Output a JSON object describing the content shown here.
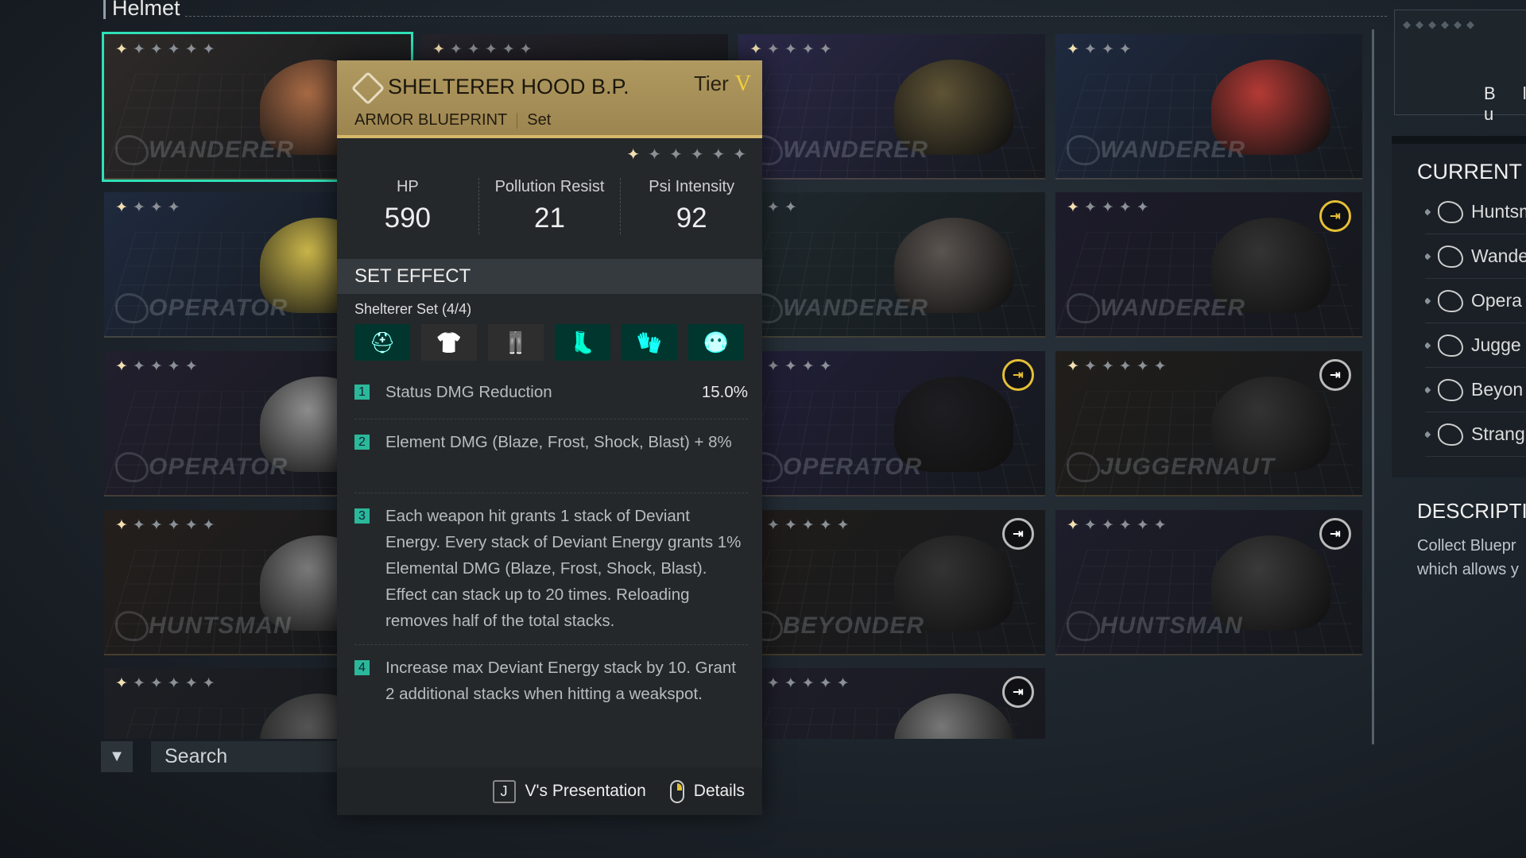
{
  "section_title": "Helmet",
  "search": {
    "placeholder": "Search"
  },
  "cards": [
    {
      "col": 0,
      "row": 0,
      "stars": 6,
      "brand": "WANDERER",
      "bg": "#2e2a28",
      "helmet": "#a86a45",
      "selected": true,
      "badge": null
    },
    {
      "col": 0,
      "row": 1,
      "stars": 4,
      "brand": "OPERATOR",
      "bg": "#1f2a3e",
      "helmet": "#c9b54a",
      "badge": null
    },
    {
      "col": 0,
      "row": 2,
      "stars": 5,
      "brand": "OPERATOR",
      "bg": "#221f2e",
      "helmet": "#8d8d8d",
      "badge": null
    },
    {
      "col": 0,
      "row": 3,
      "stars": 6,
      "brand": "HUNTSMAN",
      "bg": "#241f1c",
      "helmet": "#7a7a7a",
      "badge": null
    },
    {
      "col": 0,
      "row": 4,
      "stars": 6,
      "brand": "",
      "bg": "#1d1f24",
      "helmet": "#555",
      "badge": null
    },
    {
      "col": 1,
      "row": 0,
      "stars": 6,
      "brand": "",
      "bg": "#25232a",
      "helmet": "#555",
      "badge": null
    },
    {
      "col": 2,
      "row": 0,
      "stars": 5,
      "brand": "WANDERER",
      "bg": "#2a2848",
      "helmet": "#5e5335",
      "badge": null
    },
    {
      "col": 2,
      "row": 1,
      "stars": 3,
      "brand": "WANDERER",
      "bg": "#1f2a2e",
      "helmet": "#5b5450",
      "badge": null
    },
    {
      "col": 2,
      "row": 2,
      "stars": 5,
      "brand": "OPERATOR",
      "bg": "#211f38",
      "helmet": "#1e1e22",
      "badge": "gold"
    },
    {
      "col": 2,
      "row": 3,
      "stars": 6,
      "brand": "BEYONDER",
      "bg": "#201d1b",
      "helmet": "#333",
      "badge": "grey"
    },
    {
      "col": 2,
      "row": 4,
      "stars": 6,
      "brand": "",
      "bg": "#1f1e2a",
      "helmet": "#777",
      "badge": "grey"
    },
    {
      "col": 3,
      "row": 0,
      "stars": 4,
      "brand": "WANDERER",
      "bg": "#1f2a40",
      "helmet": "#b43a35",
      "badge": null
    },
    {
      "col": 3,
      "row": 1,
      "stars": 5,
      "brand": "WANDERER",
      "bg": "#1d1b2a",
      "helmet": "#333",
      "badge": "gold"
    },
    {
      "col": 3,
      "row": 2,
      "stars": 6,
      "brand": "JUGGERNAUT",
      "bg": "#211e1b",
      "helmet": "#333",
      "badge": "grey"
    },
    {
      "col": 3,
      "row": 3,
      "stars": 6,
      "brand": "HUNTSMAN",
      "bg": "#1e1d2b",
      "helmet": "#3a3a3a",
      "badge": "grey"
    }
  ],
  "tooltip": {
    "title": "SHELTERER HOOD B.P.",
    "tier_label": "Tier",
    "tier_value": "V",
    "type": "ARMOR BLUEPRINT",
    "category": "Set",
    "stars": 6,
    "stats": [
      {
        "label": "HP",
        "value": "590"
      },
      {
        "label": "Pollution Resist",
        "value": "21"
      },
      {
        "label": "Psi Intensity",
        "value": "92"
      }
    ],
    "set_effect_header": "SET EFFECT",
    "set_name": "Shelterer Set (4/4)",
    "set_pieces": [
      {
        "name": "helmet",
        "glyph": "⛑",
        "active": true
      },
      {
        "name": "top",
        "glyph": "👕",
        "active": false
      },
      {
        "name": "pants",
        "glyph": "👖",
        "active": false
      },
      {
        "name": "boots",
        "glyph": "👢",
        "active": true
      },
      {
        "name": "gloves",
        "glyph": "🧤",
        "active": true
      },
      {
        "name": "mask",
        "glyph": "😷",
        "active": true
      }
    ],
    "effects": [
      {
        "num": "1",
        "text": "Status DMG Reduction",
        "value": "15.0%"
      },
      {
        "num": "2",
        "text": "Element DMG (Blaze, Frost, Shock, Blast) + 8%"
      },
      {
        "num": "3",
        "text": "Each weapon hit grants 1 stack of Deviant Energy. Every stack of Deviant Energy grants 1% Elemental DMG (Blaze, Frost, Shock, Blast). Effect can stack up to 20 times. Reloading removes half of the total stacks."
      },
      {
        "num": "4",
        "text": "Increase max Deviant Energy stack by 10. Grant 2 additional stacks when hitting a weakspot."
      }
    ],
    "footer": {
      "key": "J",
      "presentation": "V's Presentation",
      "details": "Details"
    }
  },
  "right_panel": {
    "preview_text": "B l u",
    "current_header": "CURRENT",
    "items": [
      "Huntsm",
      "Wande",
      "Opera",
      "Jugge",
      "Beyon",
      "Strang"
    ],
    "description_header": "DESCRIPTI",
    "description_lines": [
      "Collect Bluepr",
      "which allows y"
    ]
  },
  "colors": {
    "accent": "#2fe0b8",
    "gold": "#e4bf35",
    "tooltip_header": "#b09a60",
    "effect_badge": "#2bb89a"
  }
}
